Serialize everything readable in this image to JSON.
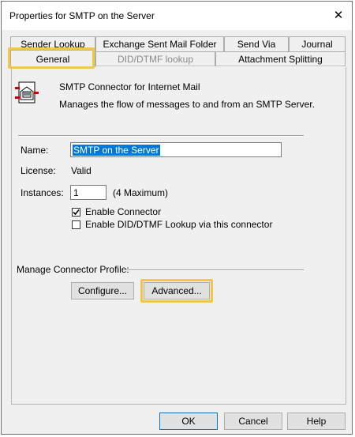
{
  "window": {
    "title": "Properties for SMTP on the Server",
    "close_glyph": "✕"
  },
  "tabs_back": [
    {
      "label": "Sender Lookup"
    },
    {
      "label": "Exchange Sent Mail Folder"
    },
    {
      "label": "Send Via"
    },
    {
      "label": "Journal"
    }
  ],
  "tabs_front": [
    {
      "label": "General"
    },
    {
      "label": "DID/DTMF lookup"
    },
    {
      "label": "Attachment Splitting"
    }
  ],
  "connector": {
    "icon": "mail-connector-icon",
    "name": "SMTP Connector for Internet Mail",
    "description": "Manages the flow of messages to and from an SMTP Server."
  },
  "fields": {
    "name_label": "Name:",
    "name_value": "SMTP on the Server",
    "license_label": "License:",
    "license_value": "Valid",
    "instances_label": "Instances:",
    "instances_value": "1",
    "instances_hint": "(4 Maximum)"
  },
  "options": {
    "enable_connector": "Enable Connector",
    "enable_connector_checked": true,
    "enable_did": "Enable DID/DTMF Lookup via this connector",
    "enable_did_checked": false
  },
  "profile": {
    "label": "Manage Connector Profile:",
    "configure": "Configure...",
    "advanced": "Advanced..."
  },
  "footer": {
    "ok": "OK",
    "cancel": "Cancel",
    "help": "Help"
  },
  "colors": {
    "highlight": "#f2c74a",
    "selection": "#0078d7"
  }
}
